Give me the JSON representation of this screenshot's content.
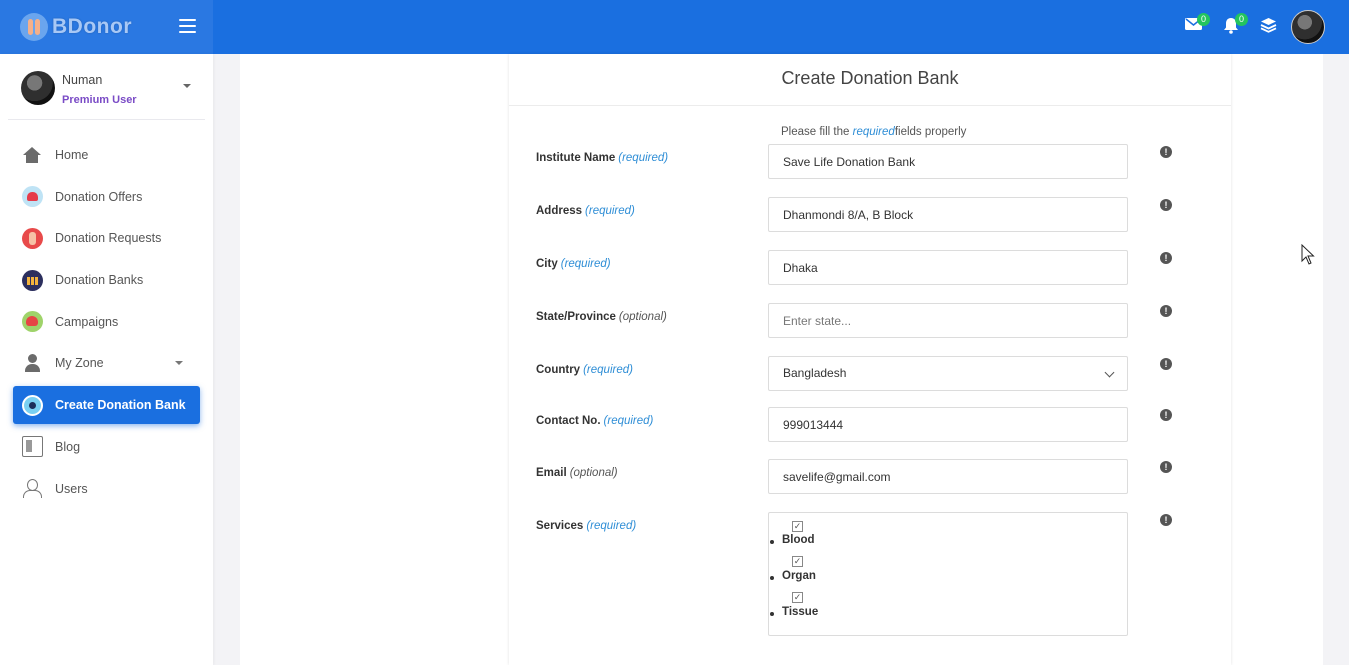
{
  "app": {
    "brand": "BDonor"
  },
  "topbar": {
    "messages_badge": "0",
    "notifications_badge": "0"
  },
  "user": {
    "name": "Numan",
    "role": "Premium User"
  },
  "sidebar": {
    "items": [
      {
        "label": "Home",
        "icon": "home-icon"
      },
      {
        "label": "Donation Offers",
        "icon": "heart-hand-icon"
      },
      {
        "label": "Donation Requests",
        "icon": "hand-request-icon"
      },
      {
        "label": "Donation Banks",
        "icon": "people-bank-icon"
      },
      {
        "label": "Campaigns",
        "icon": "campaign-heart-icon"
      },
      {
        "label": "My Zone",
        "icon": "user-icon"
      },
      {
        "label": "Create Donation Bank",
        "icon": "bank-create-icon"
      },
      {
        "label": "Blog",
        "icon": "blog-icon"
      },
      {
        "label": "Users",
        "icon": "users-icon"
      }
    ],
    "active": "Create Donation Bank"
  },
  "form": {
    "title": "Create Donation Bank",
    "hint_before": "Please fill the ",
    "hint_em": "required",
    "hint_after": "fields properly",
    "fields": {
      "institute": {
        "label": "Institute Name",
        "tag": "(required)",
        "value": "Save Life Donation Bank"
      },
      "address": {
        "label": "Address",
        "tag": "(required)",
        "value": "Dhanmondi 8/A, B Block"
      },
      "city": {
        "label": "City",
        "tag": "(required)",
        "value": "Dhaka"
      },
      "state": {
        "label": "State/Province",
        "tag": "(optional)",
        "value": "",
        "placeholder": "Enter state..."
      },
      "country": {
        "label": "Country",
        "tag": "(required)",
        "value": "Bangladesh"
      },
      "contact": {
        "label": "Contact No.",
        "tag": "(required)",
        "value": "999013444"
      },
      "email": {
        "label": "Email",
        "tag": "(optional)",
        "value": "savelife@gmail.com"
      },
      "services": {
        "label": "Services",
        "tag": "(required)",
        "options": [
          "Blood",
          "Organ",
          "Tissue"
        ]
      }
    }
  },
  "colors": {
    "primary": "#1a6fe0",
    "required_tag": "#2f8ed6",
    "role": "#7a4bc6",
    "badge": "#23c45e"
  }
}
